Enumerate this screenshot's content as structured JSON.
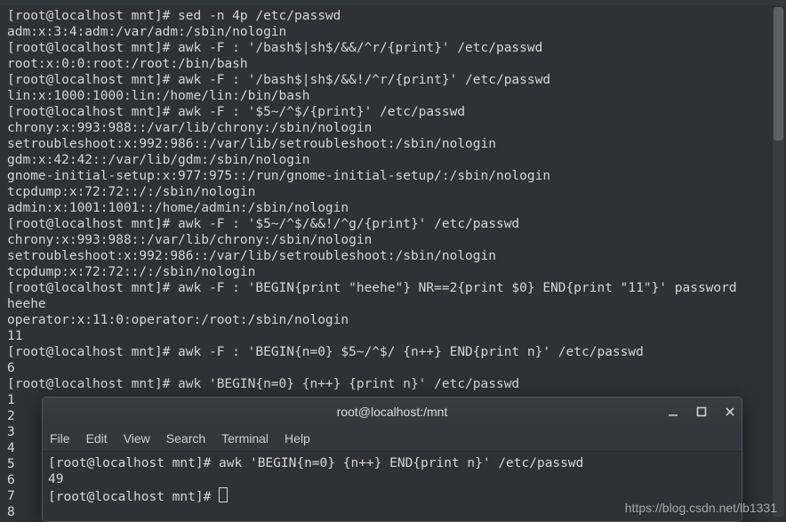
{
  "background_terminal": {
    "lines": [
      "[root@localhost mnt]# sed -n 4p /etc/passwd",
      "adm:x:3:4:adm:/var/adm:/sbin/nologin",
      "[root@localhost mnt]# awk -F : '/bash$|sh$/&&/^r/{print}' /etc/passwd",
      "root:x:0:0:root:/root:/bin/bash",
      "[root@localhost mnt]# awk -F : '/bash$|sh$/&&!/^r/{print}' /etc/passwd",
      "lin:x:1000:1000:lin:/home/lin:/bin/bash",
      "[root@localhost mnt]# awk -F : '$5~/^$/{print}' /etc/passwd",
      "chrony:x:993:988::/var/lib/chrony:/sbin/nologin",
      "setroubleshoot:x:992:986::/var/lib/setroubleshoot:/sbin/nologin",
      "gdm:x:42:42::/var/lib/gdm:/sbin/nologin",
      "gnome-initial-setup:x:977:975::/run/gnome-initial-setup/:/sbin/nologin",
      "tcpdump:x:72:72::/:/sbin/nologin",
      "admin:x:1001:1001::/home/admin:/sbin/nologin",
      "[root@localhost mnt]# awk -F : '$5~/^$/&&!/^g/{print}' /etc/passwd",
      "chrony:x:993:988::/var/lib/chrony:/sbin/nologin",
      "setroubleshoot:x:992:986::/var/lib/setroubleshoot:/sbin/nologin",
      "tcpdump:x:72:72::/:/sbin/nologin",
      "[root@localhost mnt]# awk -F : 'BEGIN{print \"heehe\"} NR==2{print $0} END{print \"11\"}' password",
      "heehe",
      "operator:x:11:0:operator:/root:/sbin/nologin",
      "11",
      "[root@localhost mnt]# awk -F : 'BEGIN{n=0} $5~/^$/ {n++} END{print n}' /etc/passwd",
      "6",
      "[root@localhost mnt]# awk 'BEGIN{n=0} {n++} {print n}' /etc/passwd",
      "1",
      "2",
      "3",
      "4",
      "5",
      "6",
      "7",
      "8"
    ]
  },
  "foreground_window": {
    "title": "root@localhost:/mnt",
    "menus": [
      "File",
      "Edit",
      "View",
      "Search",
      "Terminal",
      "Help"
    ],
    "lines": [
      "[root@localhost mnt]# awk 'BEGIN{n=0} {n++} END{print n}' /etc/passwd",
      "49",
      "[root@localhost mnt]# "
    ]
  },
  "watermark": "https://blog.csdn.net/lb1331"
}
